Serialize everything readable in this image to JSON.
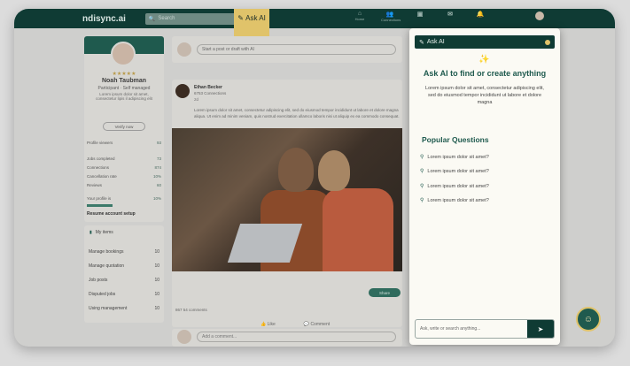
{
  "topbar": {
    "logo": "ndisync.ai",
    "search_placeholder": "Search",
    "ask_ai": "Ask AI",
    "nav": [
      "Home",
      "Connections",
      "",
      "",
      "",
      ""
    ]
  },
  "profile": {
    "stars": "★★★★★",
    "name": "Noah Taubman",
    "role": "Participant · Self managed",
    "bio": "Lorem ipsum dolor sit amet, consectetur lipis il adipiscing elit",
    "verify": "Verify now",
    "stats": [
      {
        "label": "Profile viewers",
        "value": "93"
      },
      {
        "label": "Jobs completed",
        "value": "73"
      },
      {
        "label": "Connections",
        "value": "874"
      },
      {
        "label": "Cancellation rate",
        "value": "10%"
      },
      {
        "label": "Reviews",
        "value": "60"
      },
      {
        "label": "Your profile is",
        "value": "10%"
      }
    ],
    "progress_percent": 10,
    "resume": "Resume account setup"
  },
  "menu": {
    "title": "My items",
    "items": [
      {
        "label": "Manage bookings",
        "count": "10"
      },
      {
        "label": "Manage quotation",
        "count": "10"
      },
      {
        "label": "Job posts",
        "count": "10"
      },
      {
        "label": "Disputed jobs",
        "count": "10"
      },
      {
        "label": "Using management",
        "count": "10"
      }
    ]
  },
  "postbar": {
    "placeholder": "Start a post or draft with AI"
  },
  "feed": {
    "author": "Ethan Becker",
    "connections": "6753 Connections",
    "time": "2d",
    "text": "Lorem ipsum dolor sit amet, consectetur adipiscing elit, sed do eiusmod tempor incididunt ut labore et dolore magna aliqua. Ut enim ad minim veniam, quis nostrud exercitation ullamco laboris nisi ut aliquip ex ea commodo consequat.",
    "share": "Share",
    "reactions": "867   54 comments",
    "like": "Like",
    "comment": "Comment"
  },
  "comment_placeholder": "Add a comment...",
  "ask_panel": {
    "title": "Ask AI",
    "heading": "Ask AI to find or create anything",
    "description": "Lorem ipsum dolor sit amet, consectetur adipiscing elit, sed do eiusmod tempor incididunt ut labore et dolore magna",
    "popular_title": "Popular Questions",
    "questions": [
      "Lorem ipsum dolor sit amet?",
      "Lorem ipsum dolor sit amet?",
      "Lorem ipsum dolor sit amet?",
      "Lorem ipsum dolor sit amet?"
    ],
    "input_placeholder": "Ask, write or search anything..."
  },
  "colors": {
    "primary": "#0f3b34",
    "accent": "#e0c36a",
    "heading": "#1f5a4e"
  }
}
